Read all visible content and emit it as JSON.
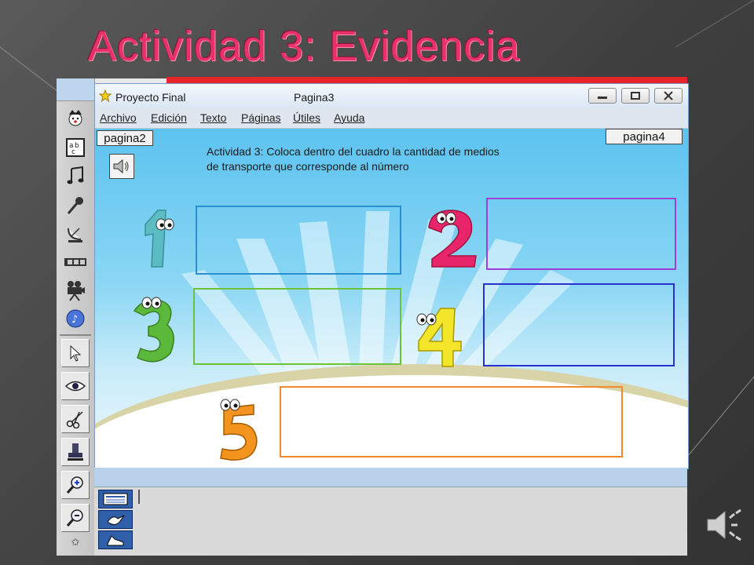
{
  "slide": {
    "title": "Actividad 3: Evidencia"
  },
  "window": {
    "app_title": "Proyecto Final",
    "page_name": "Pagina3",
    "controls": [
      "minimize",
      "restore",
      "close"
    ]
  },
  "menu": {
    "items": [
      "Archivo",
      "Edición",
      "Texto",
      "Páginas",
      "Útiles",
      "Ayuda"
    ]
  },
  "canvas": {
    "prev_button": "pagina2",
    "next_button": "pagina4",
    "instructions": "Actividad 3: Coloca dentro del cuadro la cantidad de medios de transporte que corresponde al número",
    "numbers": [
      "1",
      "2",
      "3",
      "4",
      "5"
    ],
    "box_colors": {
      "one": "#2a8fd0",
      "two": "#9b3fd6",
      "three": "#6cc23a",
      "four": "#2a2fcf",
      "five": "#f08a2c"
    },
    "number_colors": {
      "one": "#5bbcc4",
      "two": "#e8246a",
      "three": "#5bb83a",
      "four": "#f2e52a",
      "five": "#f2941e"
    }
  },
  "toolbar": {
    "icons": [
      "clown-icon",
      "text-abc-icon",
      "music-note-icon",
      "microphone-icon",
      "satellite-dish-icon",
      "film-strip-icon",
      "movie-camera-icon",
      "cd-music-icon",
      "pointer-icon",
      "eye-icon",
      "scissors-icon",
      "stamp-icon",
      "zoom-in-icon",
      "zoom-out-icon"
    ]
  },
  "colors": {
    "title": "#e8316a",
    "accent_red": "#e8242b"
  }
}
